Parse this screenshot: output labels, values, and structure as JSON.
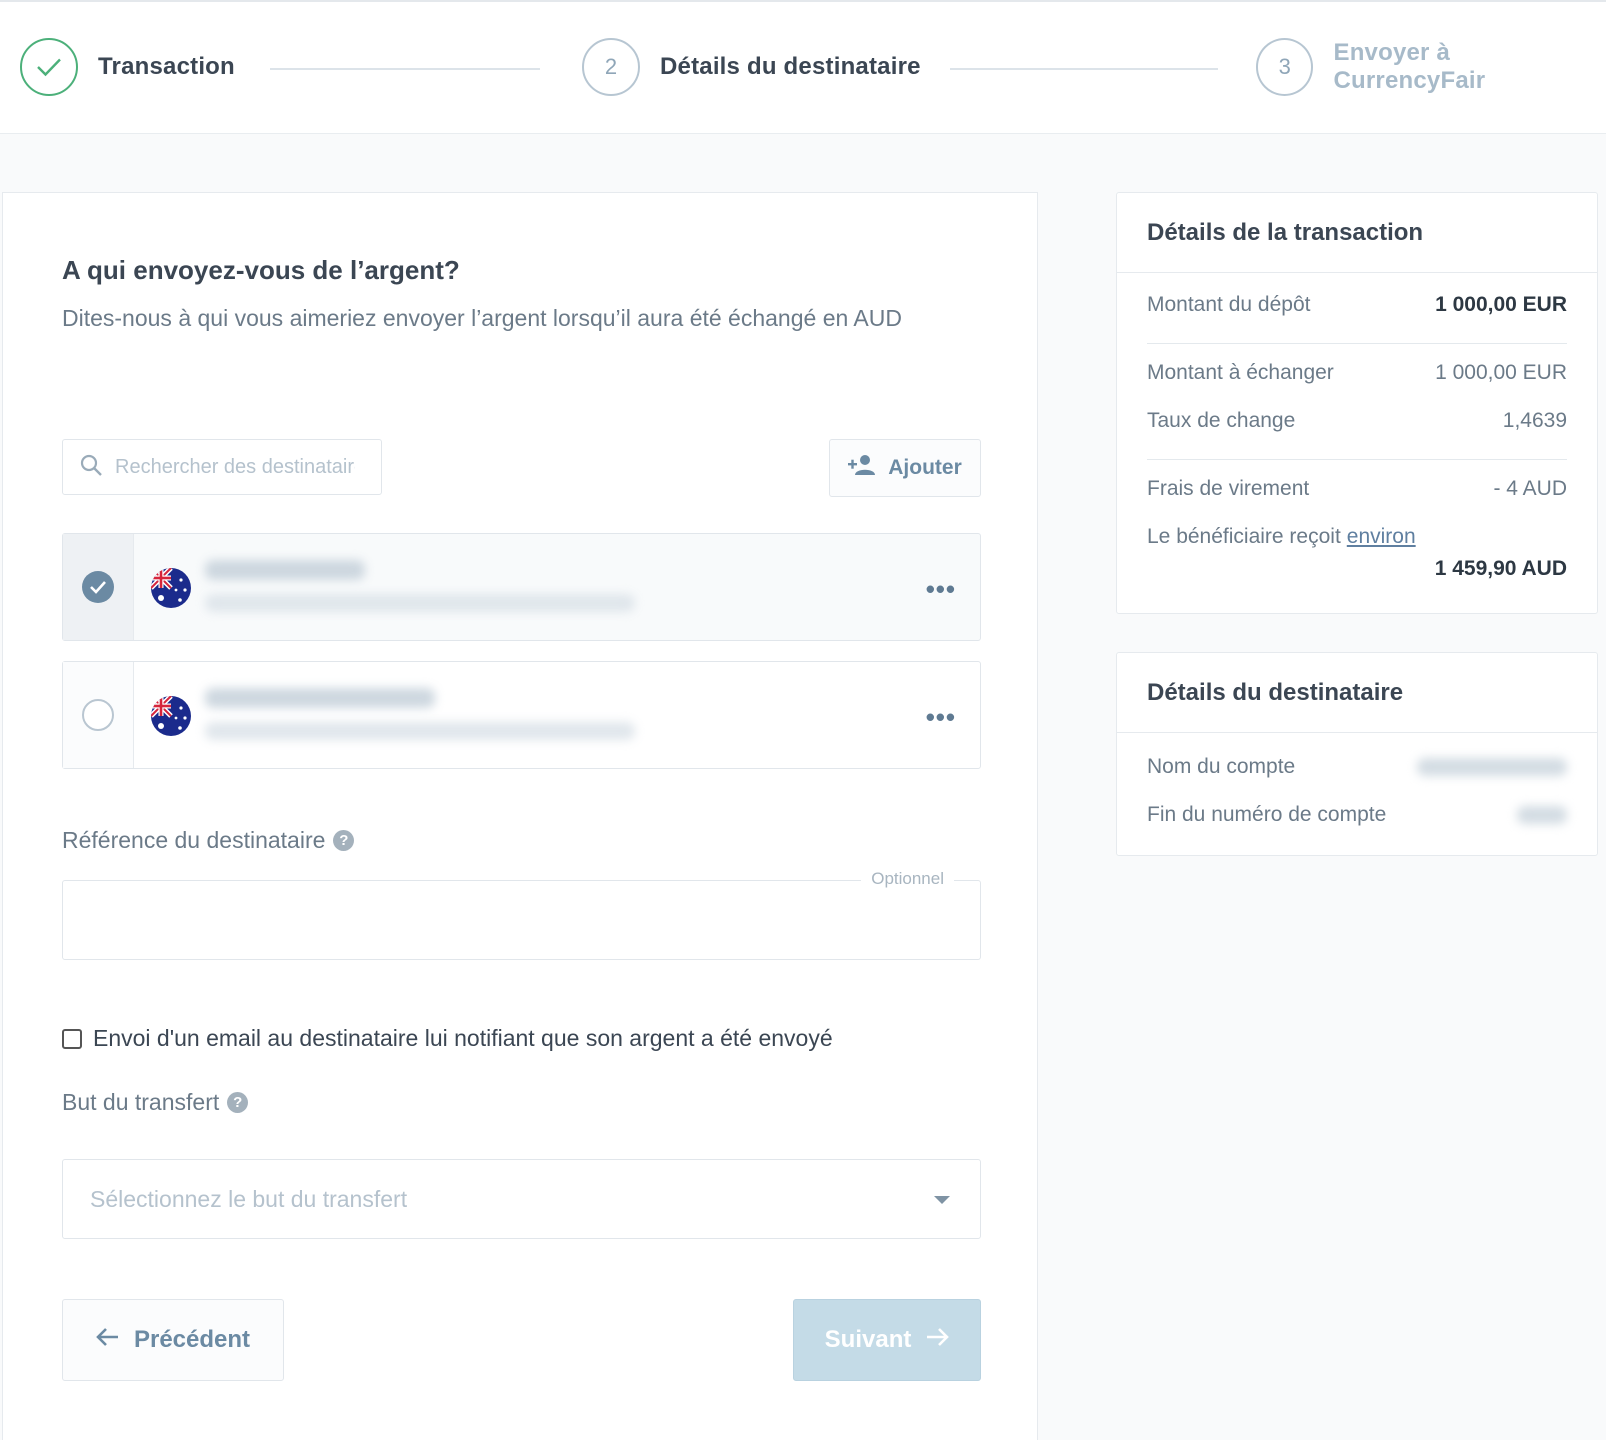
{
  "stepper": {
    "steps": [
      {
        "number": "",
        "label": "Transaction",
        "state": "done"
      },
      {
        "number": "2",
        "label": "Détails du destinataire",
        "state": "active"
      },
      {
        "number": "3",
        "label": "Envoyer à CurrencyFair",
        "state": "upcoming"
      }
    ]
  },
  "main": {
    "title": "A qui envoyez-vous de l’argent?",
    "subtitle": "Dites-nous à qui vous aimeriez envoyer l’argent lorsqu’il aura été échangé en AUD",
    "search": {
      "placeholder": "Rechercher des destinataires"
    },
    "add_button": "Ajouter",
    "recipients": [
      {
        "selected": true,
        "country": "AU",
        "more_icon": "more-horizontal-icon"
      },
      {
        "selected": false,
        "country": "AU",
        "more_icon": "more-horizontal-icon"
      }
    ],
    "reference": {
      "label": "Référence du destinataire",
      "optional_tag": "Optionnel",
      "value": ""
    },
    "notify_label": "Envoi d'un email au destinataire lui notifiant que son argent a été envoyé",
    "purpose": {
      "label": "But du transfert",
      "placeholder": "Sélectionnez le but du transfert"
    },
    "prev_button": "Précédent",
    "next_button": "Suivant"
  },
  "transaction_details": {
    "title": "Détails de la transaction",
    "deposit_label": "Montant du dépôt",
    "deposit_value": "1 000,00 EUR",
    "exchange_label": "Montant à échanger",
    "exchange_value": "1 000,00 EUR",
    "rate_label": "Taux de change",
    "rate_value": "1,4639",
    "fee_label": "Frais de virement",
    "fee_value": "- 4 AUD",
    "receives_label": "Le bénéficiaire reçoit",
    "receives_link": "environ",
    "receives_value": "1 459,90 AUD"
  },
  "recipient_details": {
    "title": "Détails du destinataire",
    "account_name_label": "Nom du compte",
    "account_end_label": "Fin du numéro de compte"
  },
  "colors": {
    "accent": "#6b8aa3",
    "success": "#4cb07a",
    "disabled_button": "#c4dbe7"
  }
}
